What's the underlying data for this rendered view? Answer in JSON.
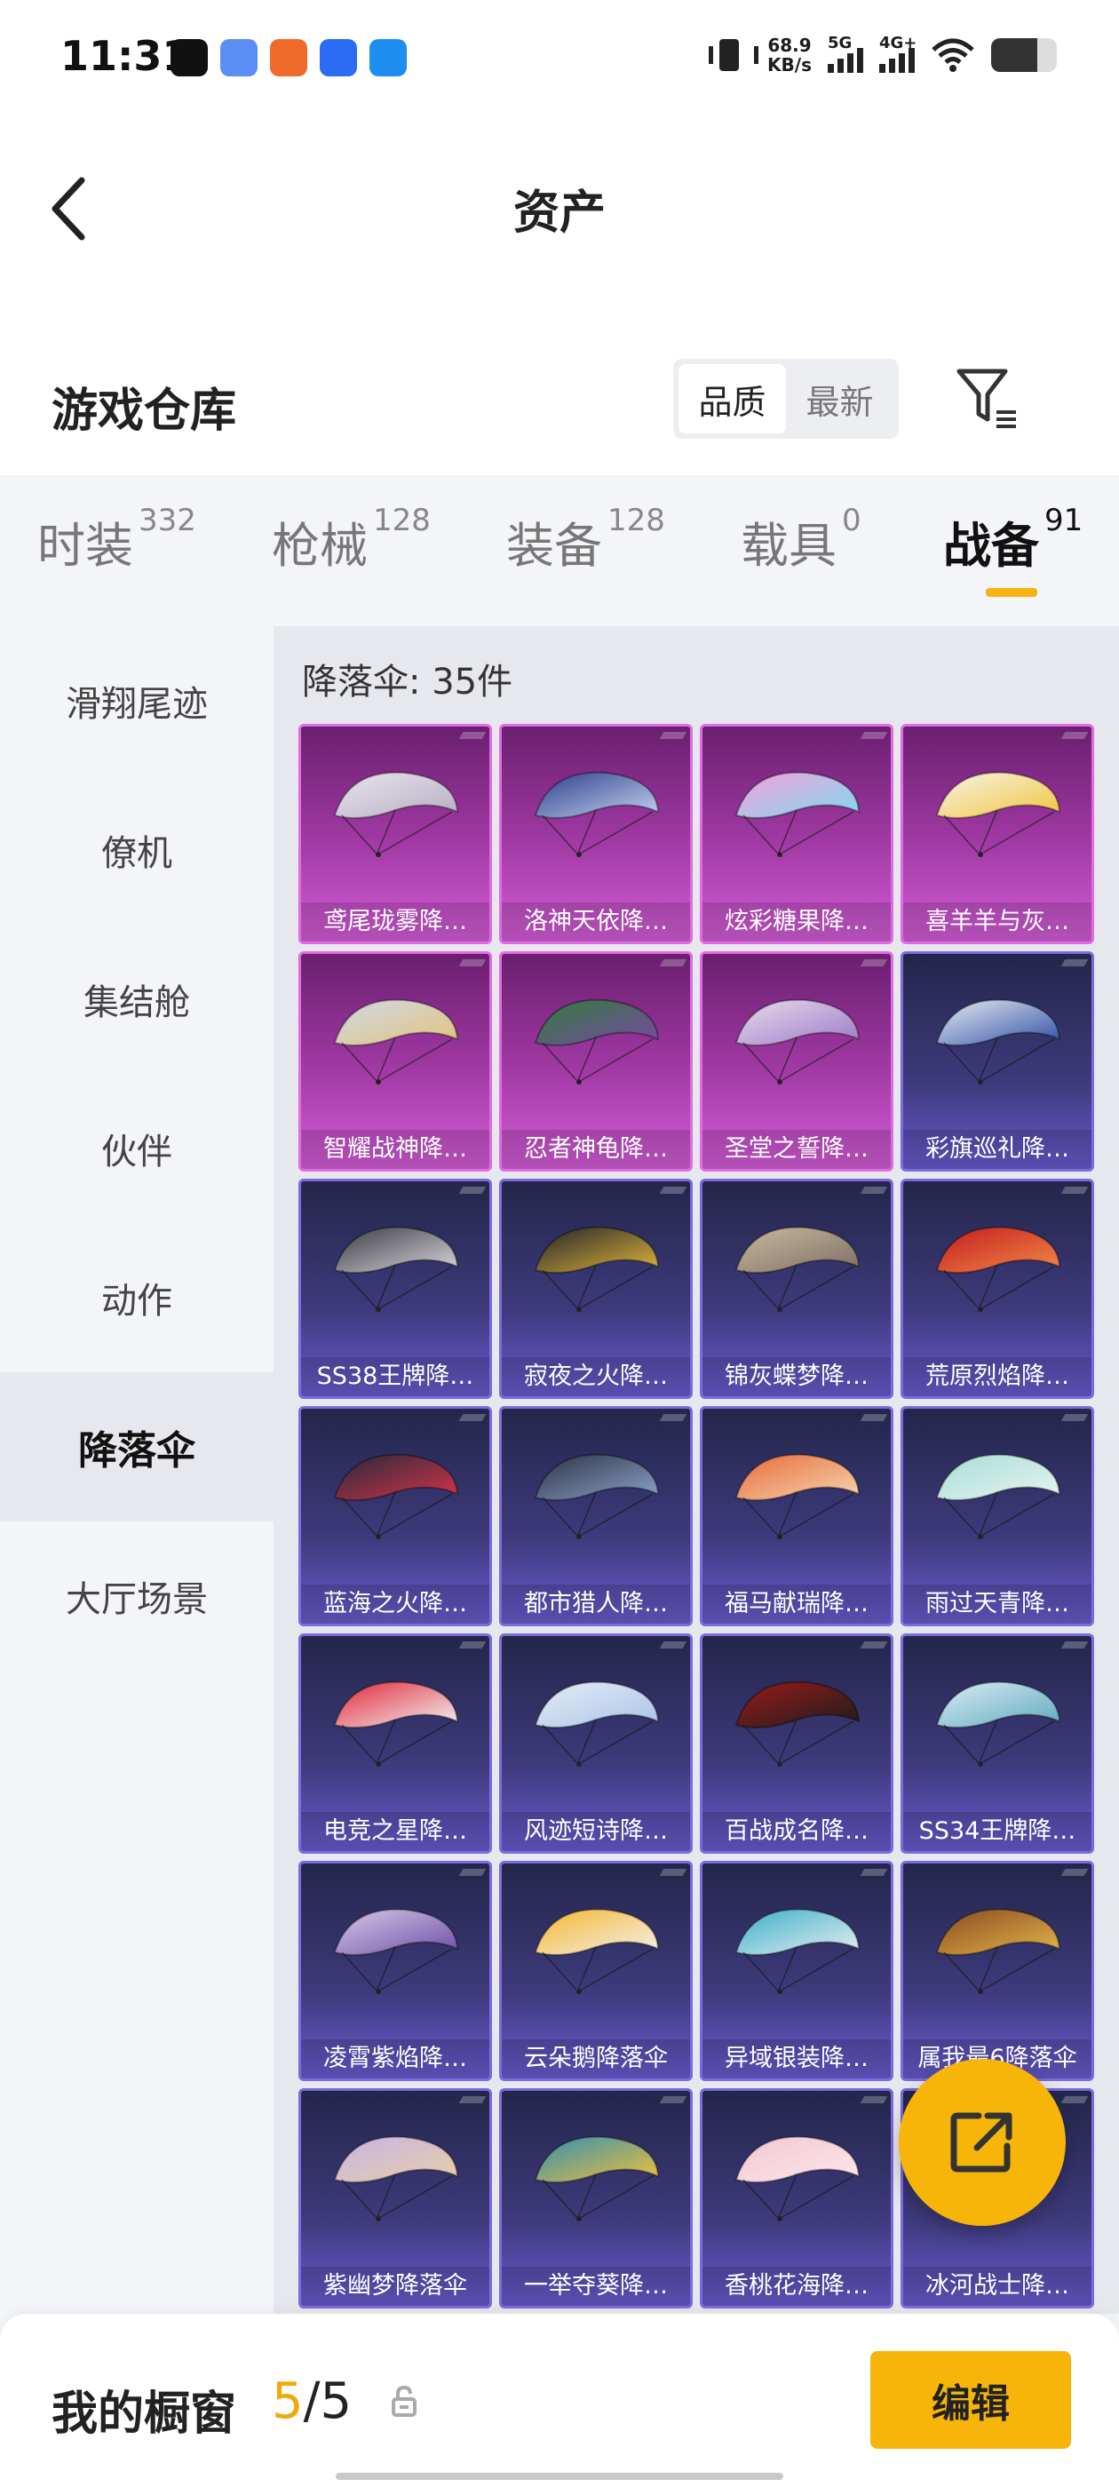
{
  "status_bar": {
    "time": "11:31",
    "net_speed_value": "68.9",
    "net_speed_unit": "KB/s",
    "signal1_label": "5G",
    "signal2_label": "4G+",
    "battery_level": 0.7,
    "notification_icons": [
      {
        "name": "tiktok-icon",
        "color": "#111111"
      },
      {
        "name": "app-blue-icon",
        "color": "#5b8ef5"
      },
      {
        "name": "app-orange-icon",
        "color": "#f06a2c"
      },
      {
        "name": "chat-icon",
        "color": "#2a6df4"
      },
      {
        "name": "browser-icon",
        "color": "#1e8ff0"
      }
    ]
  },
  "header": {
    "title": "资产"
  },
  "warehouse": {
    "title": "游戏仓库",
    "sort_options": [
      "品质",
      "最新"
    ],
    "active_sort": 0
  },
  "tabs": [
    {
      "label": "时装",
      "count": "332"
    },
    {
      "label": "枪械",
      "count": "128"
    },
    {
      "label": "装备",
      "count": "128"
    },
    {
      "label": "载具",
      "count": "0"
    },
    {
      "label": "战备",
      "count": "91",
      "active": true
    }
  ],
  "sidenav": [
    {
      "label": "滑翔尾迹"
    },
    {
      "label": "僚机"
    },
    {
      "label": "集结舱"
    },
    {
      "label": "伙伴"
    },
    {
      "label": "动作"
    },
    {
      "label": "降落伞",
      "active": true
    },
    {
      "label": "大厅场景"
    }
  ],
  "content": {
    "count_label": "降落伞: 35件",
    "items": [
      {
        "name": "鸢尾珑雾降…",
        "tier": "pink",
        "colors": [
          "#e9e4ee",
          "#b7aec2"
        ]
      },
      {
        "name": "洛神天依降…",
        "tier": "pink",
        "colors": [
          "#2c3f8a",
          "#c6d3f2"
        ]
      },
      {
        "name": "炫彩糖果降…",
        "tier": "pink",
        "colors": [
          "#f4a2d8",
          "#7fd9f2"
        ]
      },
      {
        "name": "喜羊羊与灰…",
        "tier": "pink",
        "colors": [
          "#f7f3e8",
          "#f1c53b"
        ]
      },
      {
        "name": "智耀战神降…",
        "tier": "pink",
        "colors": [
          "#cfd9e8",
          "#e2c37a"
        ]
      },
      {
        "name": "忍者神龟降…",
        "tier": "pink",
        "colors": [
          "#2f7d3a",
          "#7b47a6"
        ]
      },
      {
        "name": "圣堂之誓降…",
        "tier": "pink",
        "colors": [
          "#e7dcec",
          "#9d79c7"
        ]
      },
      {
        "name": "彩旗巡礼降…",
        "tier": "purple",
        "colors": [
          "#e8ecf4",
          "#2e4fa3"
        ]
      },
      {
        "name": "SS38王牌降…",
        "tier": "purple",
        "colors": [
          "#3a3a40",
          "#d8d8de"
        ]
      },
      {
        "name": "寂夜之火降…",
        "tier": "purple",
        "colors": [
          "#20232a",
          "#e2b53a"
        ]
      },
      {
        "name": "锦灰蝶梦降…",
        "tier": "purple",
        "colors": [
          "#cab9a0",
          "#7d6e62"
        ]
      },
      {
        "name": "荒原烈焰降…",
        "tier": "purple",
        "colors": [
          "#c41c1c",
          "#f28a4a"
        ]
      },
      {
        "name": "蓝海之火降…",
        "tier": "purple",
        "colors": [
          "#252a3a",
          "#d6334a"
        ]
      },
      {
        "name": "都市猎人降…",
        "tier": "purple",
        "colors": [
          "#2c3446",
          "#8da2c9"
        ]
      },
      {
        "name": "福马献瑞降…",
        "tier": "purple",
        "colors": [
          "#e86a3a",
          "#f6d7b0"
        ]
      },
      {
        "name": "雨过天青降…",
        "tier": "purple",
        "colors": [
          "#a8ddd5",
          "#e7f4f1"
        ]
      },
      {
        "name": "电竞之星降…",
        "tier": "purple",
        "colors": [
          "#e0283a",
          "#f4f4f4"
        ]
      },
      {
        "name": "风迹短诗降…",
        "tier": "purple",
        "colors": [
          "#e6ecf5",
          "#a9c4e8"
        ]
      },
      {
        "name": "百战成名降…",
        "tier": "purple",
        "colors": [
          "#9a1b1b",
          "#1c1c1c"
        ]
      },
      {
        "name": "SS34王牌降…",
        "tier": "purple",
        "colors": [
          "#d9eef2",
          "#5fa8c0"
        ]
      },
      {
        "name": "凌霄紫焰降…",
        "tier": "purple",
        "colors": [
          "#d6c9e6",
          "#6c4fa6"
        ]
      },
      {
        "name": "云朵鹅降落伞",
        "tier": "purple",
        "colors": [
          "#f5b630",
          "#f4f1ea"
        ]
      },
      {
        "name": "异域银装降…",
        "tier": "purple",
        "colors": [
          "#3ab0c8",
          "#e9eef2"
        ]
      },
      {
        "name": "属我最6降落伞",
        "tier": "purple",
        "colors": [
          "#8a4a20",
          "#e2b64a"
        ]
      },
      {
        "name": "紫幽梦降落伞",
        "tier": "purple",
        "colors": [
          "#c7b3e6",
          "#e8d0a6"
        ]
      },
      {
        "name": "一举夺葵降…",
        "tier": "purple",
        "colors": [
          "#2f8fb4",
          "#f2c13a"
        ]
      },
      {
        "name": "香桃花海降…",
        "tier": "purple",
        "colors": [
          "#f4c6d0",
          "#fbe8ec"
        ]
      },
      {
        "name": "冰河战士降…",
        "tier": "purple",
        "colors": [
          "#2a3a8a",
          "#6fb8e6"
        ]
      }
    ]
  },
  "bottom": {
    "title": "我的橱窗",
    "count_current": "5",
    "count_sep": "/",
    "count_total": "5",
    "edit_label": "编辑"
  },
  "colors": {
    "accent": "#f7b409",
    "tab_underline": "#f6b40e",
    "pink_tier": "#c84ecb",
    "purple_tier": "#6b5bd1"
  }
}
